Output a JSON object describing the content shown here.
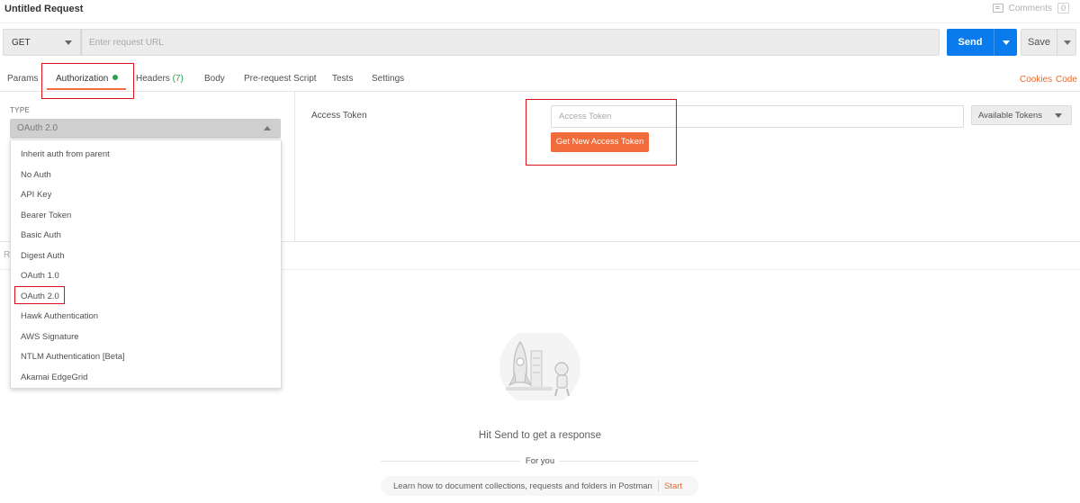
{
  "header": {
    "title": "Untitled Request",
    "comments_label": "Comments",
    "comments_count": "0",
    "icons": [
      "comment-icon"
    ]
  },
  "request": {
    "method": "GET",
    "url_placeholder": "Enter request URL",
    "url_value": "",
    "send_label": "Send",
    "save_label": "Save"
  },
  "tabs": {
    "params": "Params",
    "authorization": "Authorization",
    "headers": "Headers",
    "headers_count": "(7)",
    "body": "Body",
    "prerequest": "Pre-request Script",
    "tests": "Tests",
    "settings": "Settings",
    "cookies": "Cookies",
    "code": "Code"
  },
  "auth": {
    "type_label": "TYPE",
    "selected_type": "OAuth 2.0",
    "options": [
      "Inherit auth from parent",
      "No Auth",
      "API Key",
      "Bearer Token",
      "Basic Auth",
      "Digest Auth",
      "OAuth 1.0",
      "OAuth 2.0",
      "Hawk Authentication",
      "AWS Signature",
      "NTLM Authentication [Beta]",
      "Akamai EdgeGrid"
    ],
    "access_token_label": "Access Token",
    "access_token_placeholder": "Access Token",
    "available_tokens": "Available Tokens",
    "get_token_button": "Get New Access Token"
  },
  "response": {
    "partial_label": "R",
    "hint": "Hit Send to get a response",
    "for_you": "For you",
    "learn_text": "Learn how to document collections, requests and folders in Postman",
    "start_link": "Start"
  },
  "colors": {
    "accent": "#f26b3a",
    "send_blue": "#097bed",
    "highlight_red": "#d9141d",
    "status_green": "#27a248"
  }
}
